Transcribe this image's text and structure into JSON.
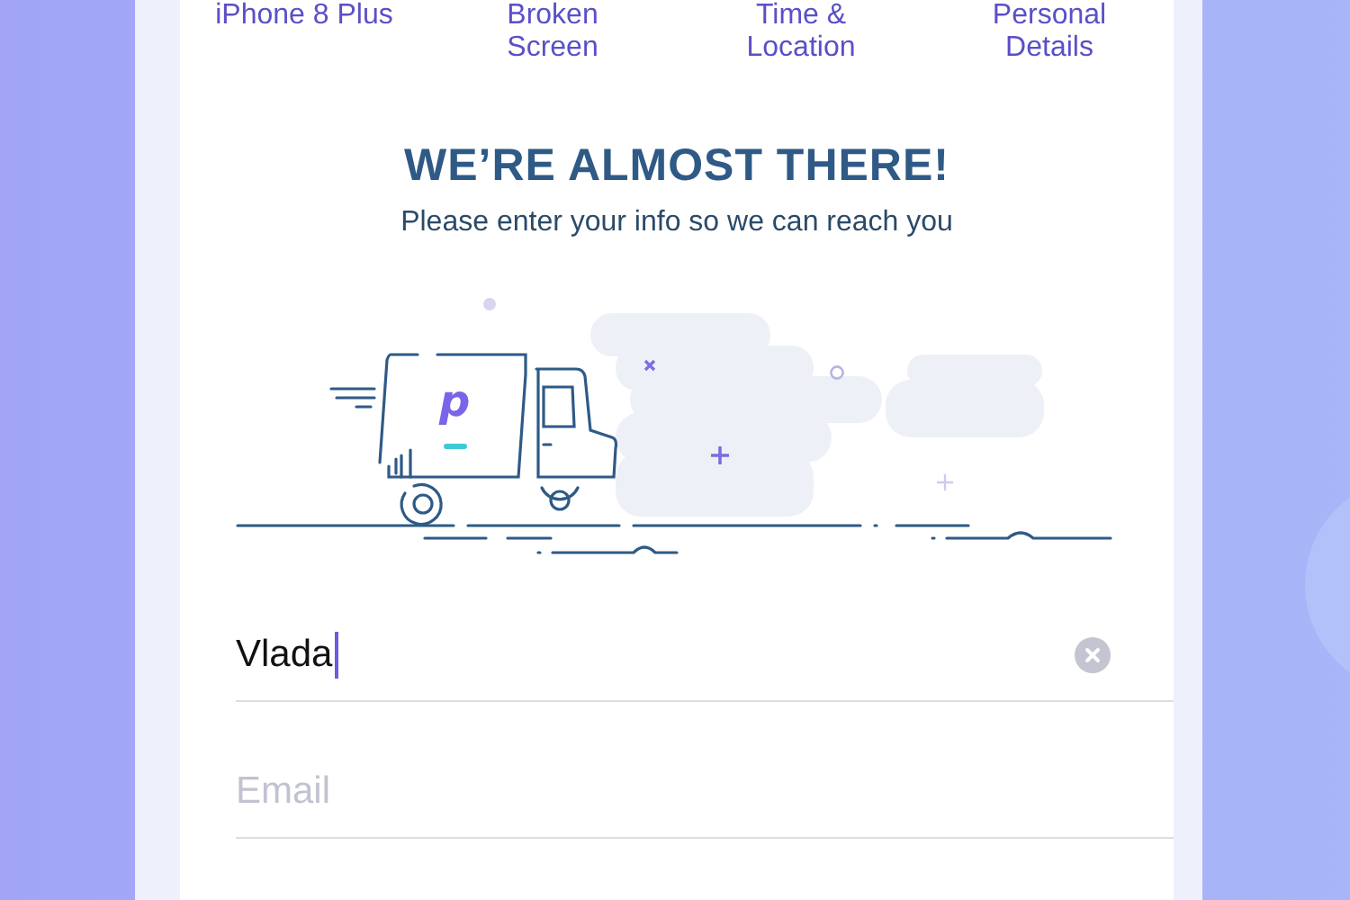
{
  "steps": [
    {
      "label": "iPhone 8 Plus"
    },
    {
      "label": "Broken Screen"
    },
    {
      "label": "Time & Location"
    },
    {
      "label": "Personal Details"
    }
  ],
  "heading": "WE’RE ALMOST THERE!",
  "subheading": "Please enter your info so we can reach you",
  "illustration": {
    "logo_letter": "p"
  },
  "fields": [
    {
      "kind": "text",
      "value": "Vlada",
      "focused": true,
      "clearable": true
    },
    {
      "kind": "placeholder",
      "placeholder": "Email",
      "focused": false,
      "clearable": false
    }
  ]
}
